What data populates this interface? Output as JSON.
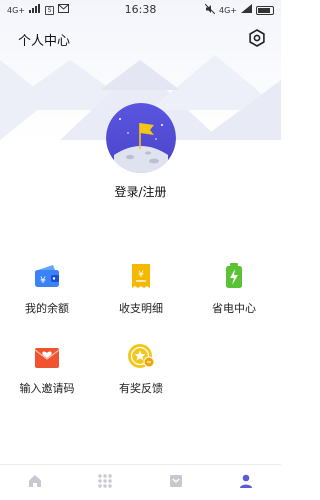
{
  "status_bar": {
    "network_left": "4G+",
    "time": "16:38",
    "network_right": "4G+",
    "icons": [
      "signal-icon",
      "notification-box-icon",
      "mail-icon",
      "mute-icon",
      "wifi-icon",
      "battery-icon"
    ]
  },
  "header": {
    "title": "个人中心",
    "settings_icon": "gear-icon"
  },
  "profile": {
    "avatar_icon": "moon-flag-avatar",
    "login_label": "登录/注册"
  },
  "grid": {
    "items": [
      {
        "label": "我的余额",
        "icon": "wallet-icon",
        "color": "#3b82f6"
      },
      {
        "label": "收支明细",
        "icon": "receipt-icon",
        "color": "#f5b800"
      },
      {
        "label": "省电中心",
        "icon": "battery-charge-icon",
        "color": "#5bc236"
      },
      {
        "label": "输入邀请码",
        "icon": "invite-envelope-icon",
        "color": "#f0532f"
      },
      {
        "label": "有奖反馈",
        "icon": "reward-coin-icon",
        "color": "#f5c518"
      }
    ]
  },
  "tabbar": {
    "tabs": [
      {
        "icon": "home-icon",
        "active": false
      },
      {
        "icon": "apps-grid-icon",
        "active": false
      },
      {
        "icon": "inbox-icon",
        "active": false
      },
      {
        "icon": "profile-icon",
        "active": true
      }
    ],
    "active_color": "#5b5bd6",
    "inactive_color": "#c8c8d0"
  }
}
